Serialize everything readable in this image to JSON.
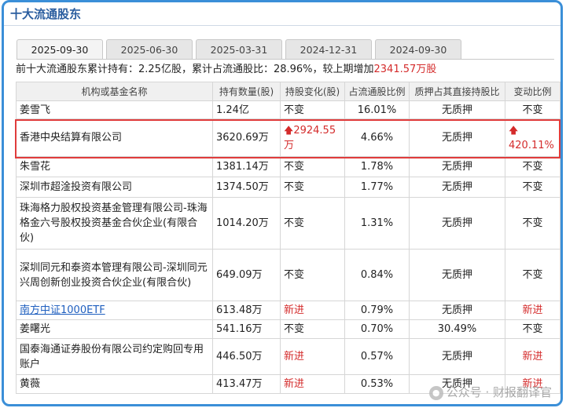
{
  "title": "十大流通股东",
  "tabs": [
    "2025-09-30",
    "2025-06-30",
    "2025-03-31",
    "2024-12-31",
    "2024-09-30"
  ],
  "summary": {
    "prefix": "前十大流通股东累计持有：2.25亿股，累计占流通股比：28.96%，较上期增加",
    "change": "2341.57万股"
  },
  "table": {
    "headers": [
      "机构或基金名称",
      "持有数量(股)",
      "持股变化(股)",
      "占流通股比例",
      "质押占其直接持股比",
      "变动比例"
    ],
    "rows": [
      {
        "name": "姜雪飞",
        "qty": "1.24亿",
        "change": "不变",
        "ratio": "16.01%",
        "pledge": "无质押",
        "pct": "不变"
      },
      {
        "name": "香港中央结算有限公司",
        "qty": "3620.69万",
        "change": "2924.55万",
        "ratio": "4.66%",
        "pledge": "无质押",
        "pct": "420.11%"
      },
      {
        "name": "朱雪花",
        "qty": "1381.14万",
        "change": "不变",
        "ratio": "1.78%",
        "pledge": "无质押",
        "pct": "不变"
      },
      {
        "name": "深圳市超淦投资有限公司",
        "qty": "1374.50万",
        "change": "不变",
        "ratio": "1.77%",
        "pledge": "无质押",
        "pct": "不变"
      },
      {
        "name": "珠海格力股权投资基金管理有限公司-珠海格金六号股权投资基金合伙企业(有限合伙)",
        "qty": "1014.20万",
        "change": "不变",
        "ratio": "1.31%",
        "pledge": "无质押",
        "pct": "不变"
      },
      {
        "name": "深圳同元和泰资本管理有限公司-深圳同元兴周创新创业投资合伙企业(有限合伙)",
        "qty": "649.09万",
        "change": "不变",
        "ratio": "0.84%",
        "pledge": "无质押",
        "pct": "不变"
      },
      {
        "name": "南方中证1000ETF",
        "qty": "613.48万",
        "change": "新进",
        "ratio": "0.79%",
        "pledge": "无质押",
        "pct": "新进"
      },
      {
        "name": "姜曙光",
        "qty": "541.16万",
        "change": "不变",
        "ratio": "0.70%",
        "pledge": "30.49%",
        "pct": "不变"
      },
      {
        "name": "国泰海通证券股份有限公司约定购回专用账户",
        "qty": "446.50万",
        "change": "新进",
        "ratio": "0.57%",
        "pledge": "无质押",
        "pct": "新进"
      },
      {
        "name": "黄薇",
        "qty": "413.47万",
        "change": "新进",
        "ratio": "0.53%",
        "pledge": "无质押",
        "pct": "新进"
      }
    ]
  },
  "watermark": "公众号 · 财报翻译官",
  "colors": {
    "accent": "#3b8fd8",
    "red": "#d42b2b",
    "link": "#1f5fbf",
    "highlight": "#e03c3c"
  }
}
